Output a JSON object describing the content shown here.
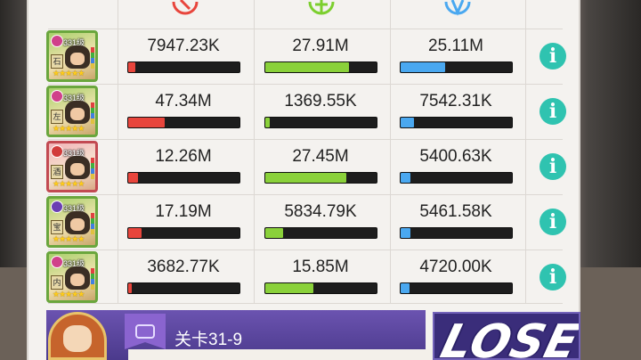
{
  "header": {
    "attack_icon": "sword-icon",
    "heal_icon": "plus-cross-icon",
    "defense_icon": "shield-icon"
  },
  "rows": [
    {
      "level": "331级",
      "tag": "石",
      "stars": "★★★★★",
      "attack": "7947.23K",
      "attack_fill": 0.06,
      "heal": "27.91M",
      "heal_fill": 0.75,
      "defense": "25.11M",
      "defense_fill": 0.4
    },
    {
      "level": "331级",
      "tag": "左",
      "stars": "★★★★★",
      "attack": "47.34M",
      "attack_fill": 0.33,
      "heal": "1369.55K",
      "heal_fill": 0.04,
      "defense": "7542.31K",
      "defense_fill": 0.12
    },
    {
      "level": "331级",
      "tag": "酒",
      "stars": "★★★★★",
      "attack": "12.26M",
      "attack_fill": 0.09,
      "heal": "27.45M",
      "heal_fill": 0.73,
      "defense": "5400.63K",
      "defense_fill": 0.09
    },
    {
      "level": "331级",
      "tag": "宝",
      "stars": "★★★★★",
      "attack": "17.19M",
      "attack_fill": 0.12,
      "heal": "5834.79K",
      "heal_fill": 0.16,
      "defense": "5461.58K",
      "defense_fill": 0.09
    },
    {
      "level": "331级",
      "tag": "内",
      "stars": "★★★★★",
      "attack": "3682.77K",
      "attack_fill": 0.03,
      "heal": "15.85M",
      "heal_fill": 0.43,
      "defense": "4720.00K",
      "defense_fill": 0.08
    }
  ],
  "info_glyph": "i",
  "colors": {
    "attack": "#e8453c",
    "heal": "#8ad13a",
    "defense": "#4aa8f0"
  },
  "footer": {
    "stage": "关卡31-9",
    "result": "LOSE"
  }
}
